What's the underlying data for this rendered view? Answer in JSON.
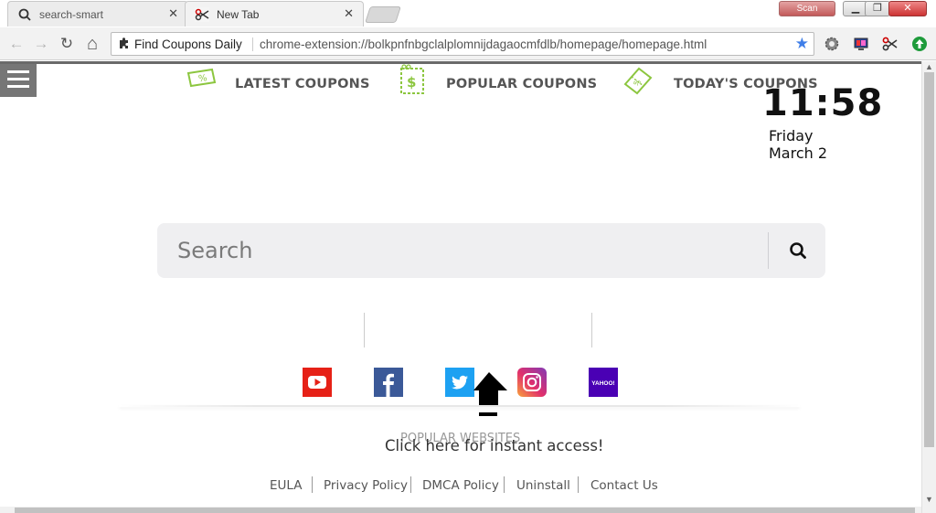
{
  "browser": {
    "tabs": [
      {
        "title": "search-smart",
        "close": "✕"
      },
      {
        "title": "New Tab",
        "close": "✕"
      }
    ],
    "window": {
      "scan_label": "Scan",
      "minimize": "▁",
      "maximize": "❐",
      "close": "✕"
    },
    "toolbar": {
      "back": "←",
      "forward": "→",
      "reload": "↻",
      "home": "⌂",
      "extension_name": "Find Coupons Daily",
      "url": "chrome-extension://bolkpnfnbgclalplomnijdagaocmfdlb/homepage/homepage.html",
      "star": "★"
    }
  },
  "clock": {
    "time": "11:58",
    "day": "Friday",
    "date": "March 2"
  },
  "search": {
    "placeholder": "Search"
  },
  "coupons": [
    {
      "label": "LATEST COUPONS"
    },
    {
      "label": "POPULAR COUPONS"
    },
    {
      "label": "TODAY'S COUPONS"
    }
  ],
  "sites": [
    {
      "name": "youtube",
      "color": "#e62117"
    },
    {
      "name": "facebook",
      "color": "#3b5998"
    },
    {
      "name": "twitter",
      "color": "#1da1f2"
    },
    {
      "name": "instagram",
      "color": "#c13584"
    },
    {
      "name": "yahoo",
      "color": "#4a00b4",
      "text": "YAHOO!"
    }
  ],
  "popular_label": "POPULAR WEBSITES",
  "instant_access": "Click here for instant access!",
  "footer": [
    "EULA",
    "Privacy Policy",
    "DMCA Policy",
    "Uninstall",
    "Contact Us"
  ],
  "colors": {
    "accent_green": "#8cc63f",
    "search_bg": "#efeff1"
  }
}
